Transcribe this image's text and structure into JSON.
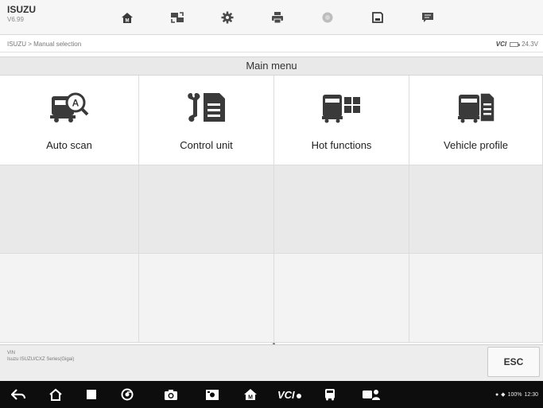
{
  "header": {
    "brand": "ISUZU",
    "version": "V6.99"
  },
  "toolbar": [
    {
      "name": "home-toolbar-button",
      "icon": "home-icon"
    },
    {
      "name": "vehicle-swap-button",
      "icon": "vehicle-swap-icon"
    },
    {
      "name": "settings-button",
      "icon": "gear-icon"
    },
    {
      "name": "print-button",
      "icon": "printer-icon"
    },
    {
      "name": "help-button",
      "icon": "help-icon"
    },
    {
      "name": "save-button",
      "icon": "save-icon"
    },
    {
      "name": "data-logging-button",
      "icon": "message-icon"
    }
  ],
  "breadcrumb": "ISUZU > Manual selection",
  "status": {
    "vci": "VCI",
    "voltage": "24.3V"
  },
  "menu": {
    "title": "Main menu",
    "items": [
      {
        "label": "Auto scan",
        "icon": "auto-scan-icon"
      },
      {
        "label": "Control unit",
        "icon": "control-unit-icon"
      },
      {
        "label": "Hot functions",
        "icon": "hot-functions-icon"
      },
      {
        "label": "Vehicle profile",
        "icon": "vehicle-profile-icon"
      }
    ]
  },
  "info": {
    "vin_label": "VIN",
    "vehicle": "Isuzu ISUZU/CXZ Series(Gigai)"
  },
  "esc_label": "ESC",
  "system": {
    "battery": "100%",
    "time": "12:30"
  },
  "colors": {
    "icon": "#3a3a3a",
    "navbar": "#0d0d0d",
    "toolbar_icon": "#4a4a4a"
  }
}
